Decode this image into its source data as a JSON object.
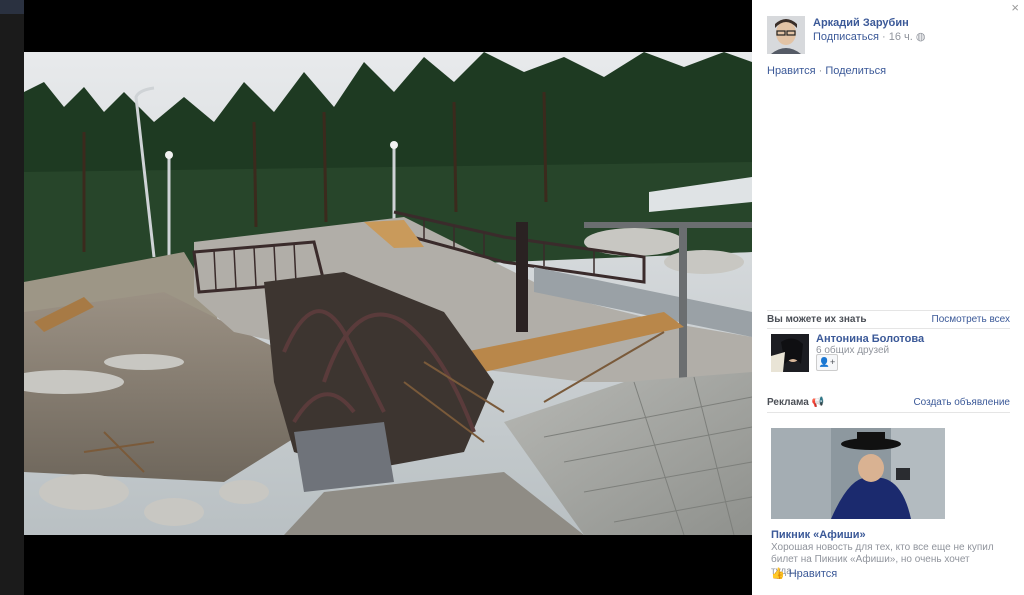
{
  "photo": {
    "alt": "",
    "colors": {
      "sky": "#d9dde0",
      "forest": "#1f3a22",
      "water": "#8e8476",
      "pavement": "#a9a9a6"
    }
  },
  "author": {
    "name": "Аркадий Зарубин",
    "follow": "Подписаться",
    "time": "16 ч.",
    "avatar_icon": "user-avatar"
  },
  "actions": {
    "like": "Нравится",
    "share": "Поделиться"
  },
  "suggestions": {
    "title": "Вы можете их знать",
    "see_all": "Посмотреть всех",
    "person": {
      "name": "Антонина Болотова",
      "mutual": "6 общих друзей",
      "add_icon": "add-friend-icon"
    }
  },
  "ads": {
    "title": "Реклама",
    "create": "Создать объявление",
    "ad": {
      "title": "Пикник «Афиши»",
      "text": "Хорошая новость для тех, кто все еще не купил билет на Пикник «Афиши», но очень хочет туда...",
      "like": "Нравится"
    }
  },
  "ui": {
    "close_glyph": "×",
    "dot": "·",
    "accent": "#3b5998"
  }
}
